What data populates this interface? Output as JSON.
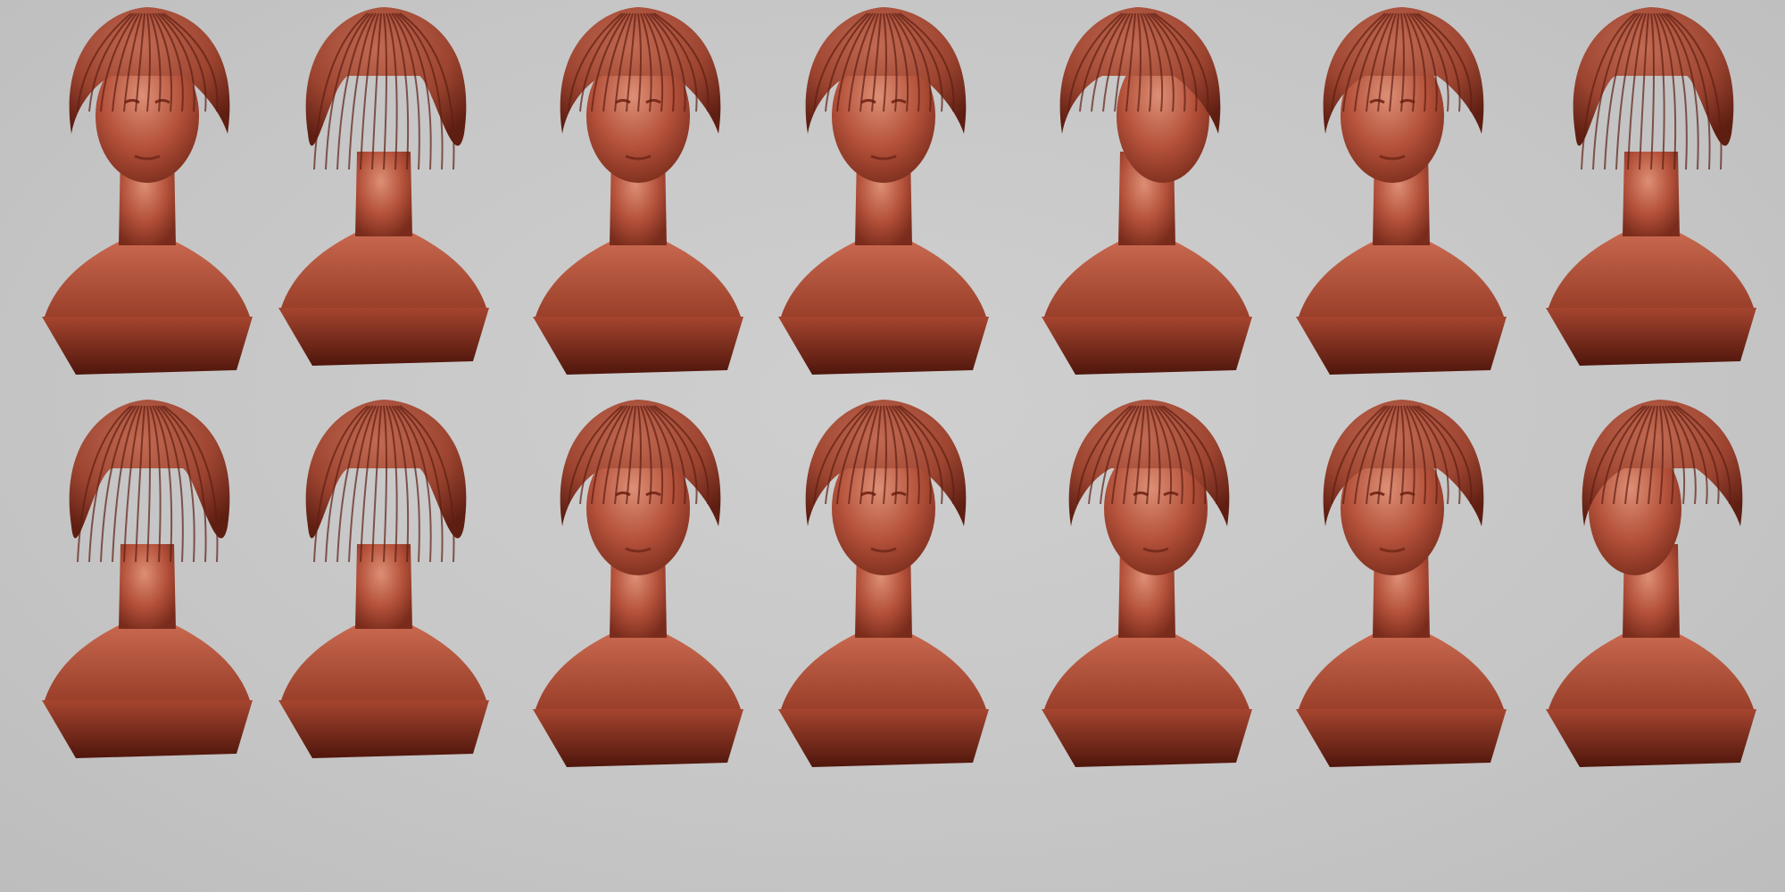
{
  "scene": {
    "background": "#c8c8c8",
    "material_color": "#b5523b",
    "material_shadow": "#6e2417",
    "material_highlight": "#d9866d"
  },
  "busts": [
    {
      "row": 1,
      "view": "front-slight-down"
    },
    {
      "row": 1,
      "view": "back-top"
    },
    {
      "row": 1,
      "view": "front"
    },
    {
      "row": 1,
      "view": "front"
    },
    {
      "row": 1,
      "view": "right-profile"
    },
    {
      "row": 1,
      "view": "left-three-quarter"
    },
    {
      "row": 1,
      "view": "back-three-quarter"
    },
    {
      "row": 2,
      "view": "back-three-quarter"
    },
    {
      "row": 2,
      "view": "back"
    },
    {
      "row": 2,
      "view": "front-low"
    },
    {
      "row": 2,
      "view": "front-tilted-down"
    },
    {
      "row": 2,
      "view": "right-three-quarter"
    },
    {
      "row": 2,
      "view": "left-back-three-quarter"
    },
    {
      "row": 2,
      "view": "left-profile"
    }
  ]
}
